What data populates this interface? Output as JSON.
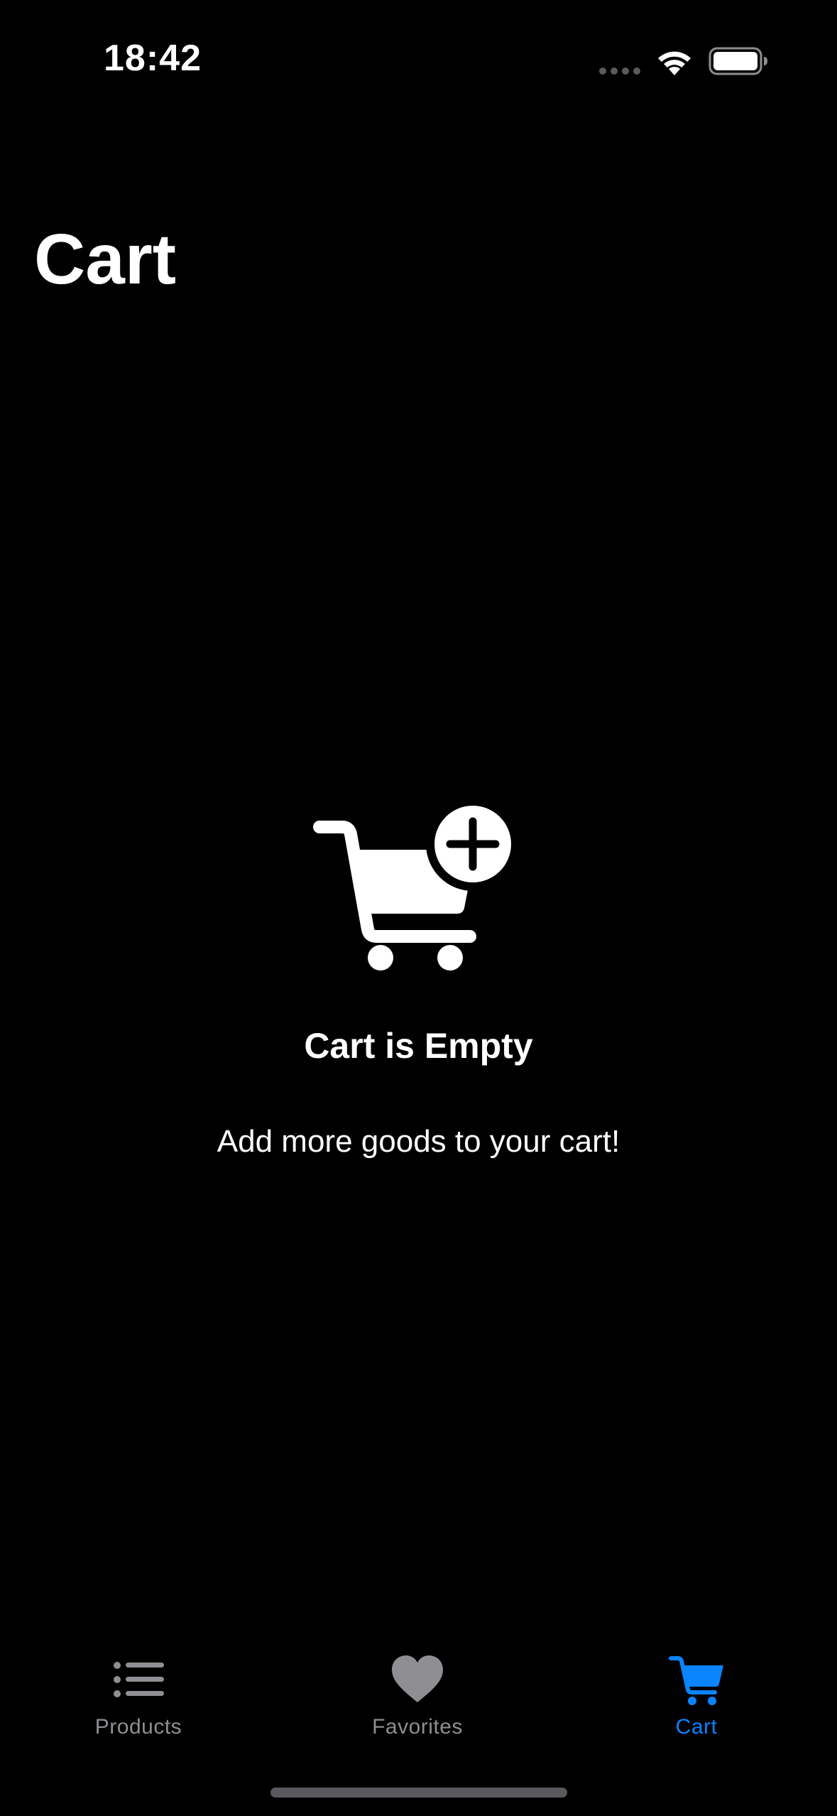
{
  "status_bar": {
    "time": "18:42",
    "icons": [
      "signal-icon",
      "wifi-icon",
      "battery-icon"
    ]
  },
  "header": {
    "title": "Cart"
  },
  "empty_state": {
    "icon": "cart-plus-icon",
    "title": "Cart is Empty",
    "subtitle": "Add more goods to your cart!"
  },
  "tab_bar": {
    "tabs": [
      {
        "label": "Products",
        "icon": "list-icon",
        "active": false
      },
      {
        "label": "Favorites",
        "icon": "heart-icon",
        "active": false
      },
      {
        "label": "Cart",
        "icon": "cart-icon",
        "active": true
      }
    ]
  },
  "colors": {
    "background": "#000000",
    "accent": "#0a84ff",
    "inactive": "#8e8e93",
    "text": "#ffffff"
  }
}
